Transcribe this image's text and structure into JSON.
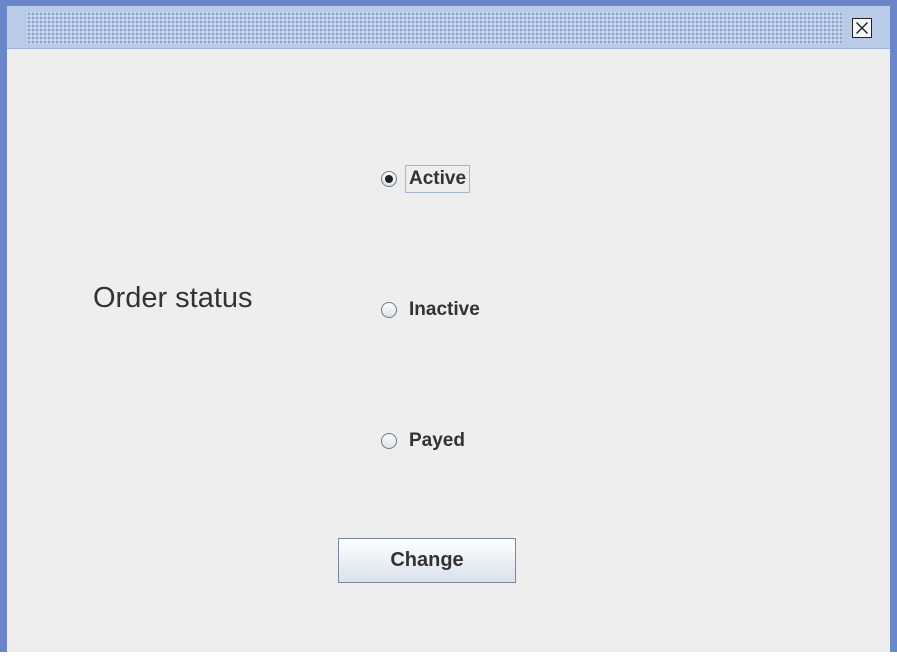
{
  "window": {
    "close_icon": "close-icon"
  },
  "form": {
    "label": "Order status",
    "options": [
      {
        "label": "Active",
        "checked": true
      },
      {
        "label": "Inactive",
        "checked": false
      },
      {
        "label": "Payed",
        "checked": false
      }
    ],
    "button_label": "Change"
  },
  "colors": {
    "frame": "#6a86c8",
    "titlebar": "#b9cbe6",
    "content_background": "#eeeeee"
  }
}
